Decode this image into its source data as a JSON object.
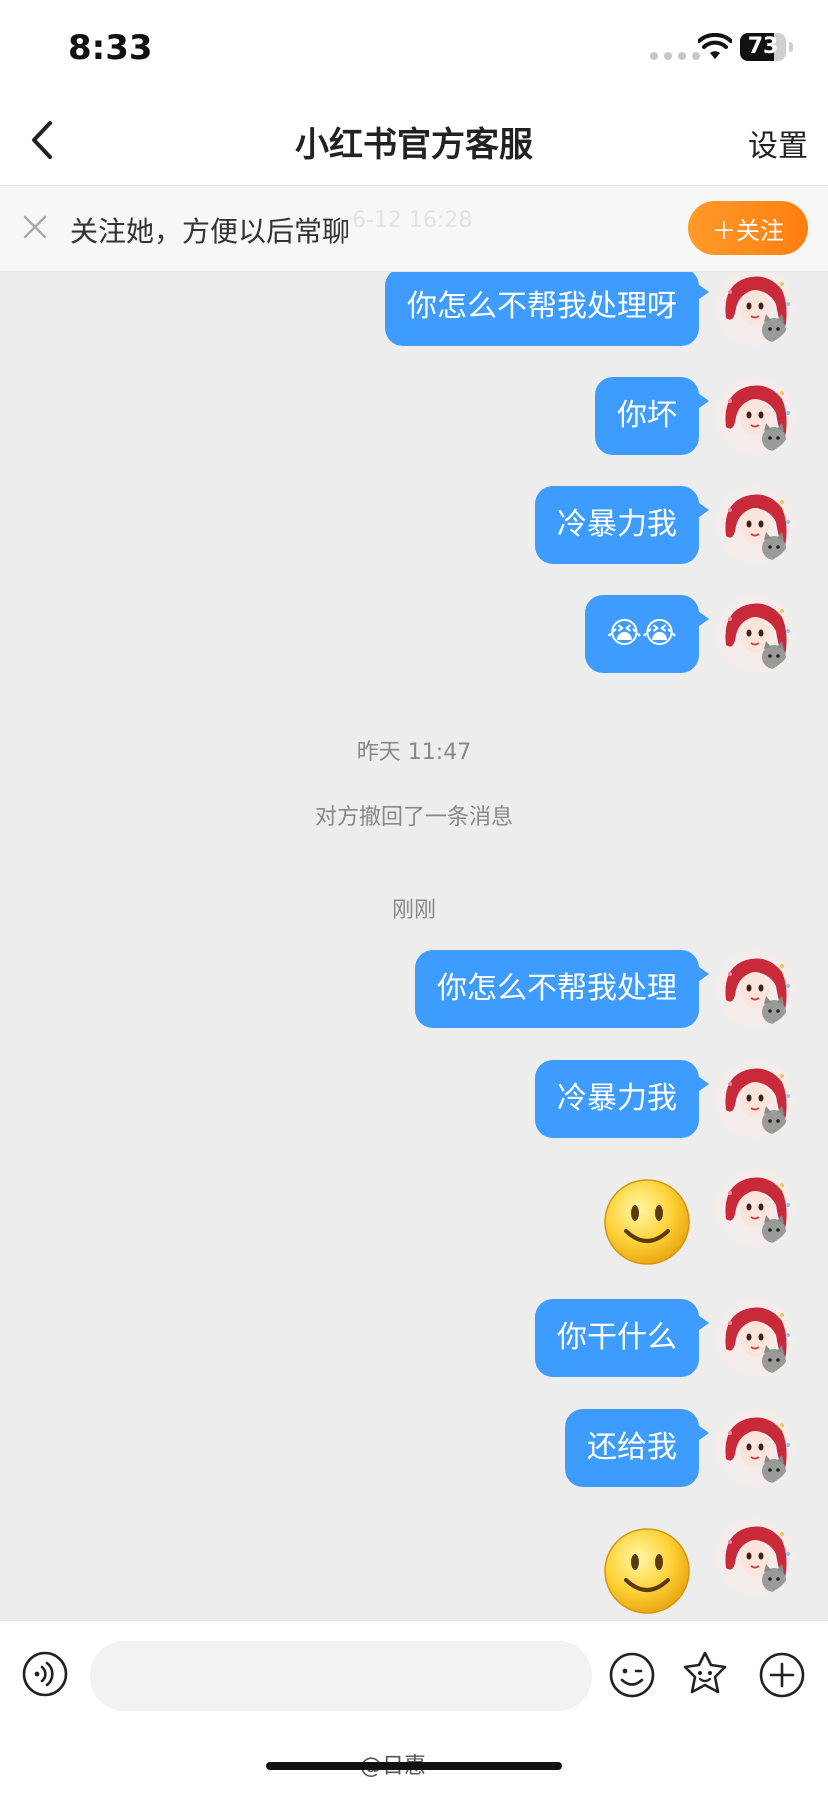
{
  "status": {
    "time": "8:33",
    "battery": "73",
    "battery_level": 0.73
  },
  "nav": {
    "title": "小红书官方客服",
    "settings": "设置"
  },
  "follow_bar": {
    "text": "关注她，方便以后常聊",
    "button": "＋关注",
    "faded_time": "6-12 16:28"
  },
  "messages": [
    {
      "text": "你怎么不帮我处理呀"
    },
    {
      "text": "你坏"
    },
    {
      "text": "冷暴力我"
    },
    {
      "text": "😭😭"
    },
    {
      "text": "你怎么不帮我处理"
    },
    {
      "text": "冷暴力我"
    },
    {
      "text": "你干什么"
    },
    {
      "text": "还给我"
    }
  ],
  "system": {
    "time1": "昨天 11:47",
    "recalled": "对方撤回了一条消息",
    "time2": "刚刚"
  },
  "bottom": {
    "input_placeholder": ""
  },
  "watermark": "@日惠",
  "colors": {
    "bubble": "#3f9cff",
    "follow_button": "#ff8a1a",
    "background": "#ededed"
  }
}
